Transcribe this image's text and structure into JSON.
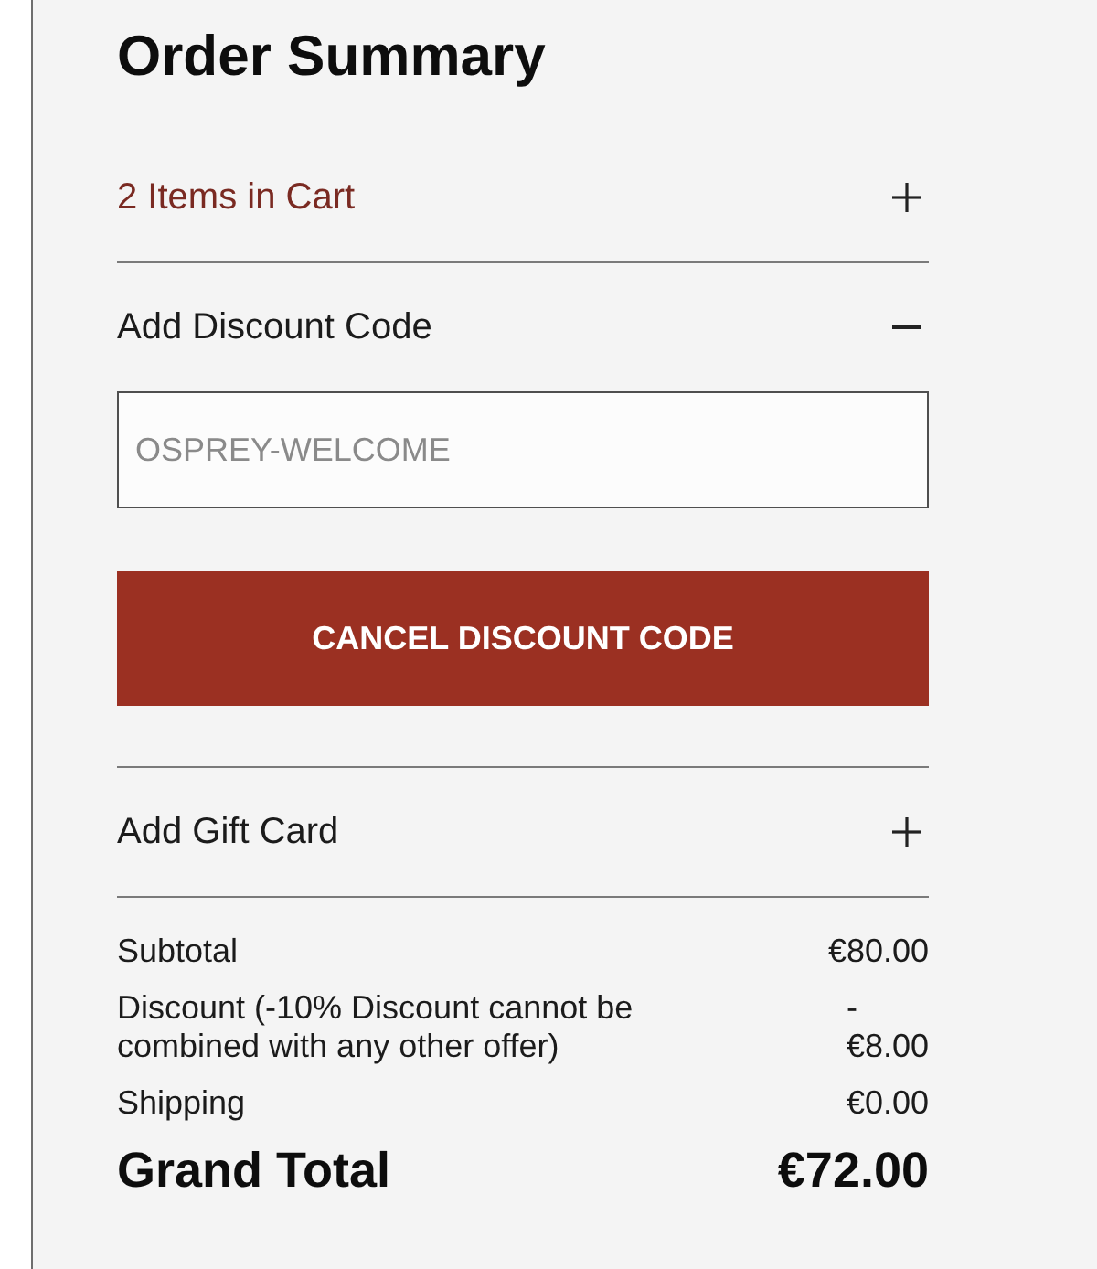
{
  "title": "Order Summary",
  "sections": [
    {
      "kind": "cart",
      "label": "2 Items in Cart",
      "expanded": false
    },
    {
      "kind": "discount",
      "label": "Add Discount Code",
      "expanded": true,
      "field": {
        "value": "OSPREY-WELCOME",
        "disabled": true
      },
      "button": "CANCEL DISCOUNT CODE"
    },
    {
      "kind": "gift_card",
      "label": "Add Gift Card",
      "expanded": false
    }
  ],
  "totals": [
    {
      "kind": "line",
      "label": "Subtotal",
      "value": "€80.00"
    },
    {
      "kind": "line",
      "label": "Discount (-10% Discount cannot be combined with any other offer)",
      "value": "- €8.00"
    },
    {
      "kind": "line",
      "label": "Shipping",
      "value": "€0.00"
    },
    {
      "kind": "grand",
      "label": "Grand Total",
      "value": "€72.00"
    }
  ]
}
